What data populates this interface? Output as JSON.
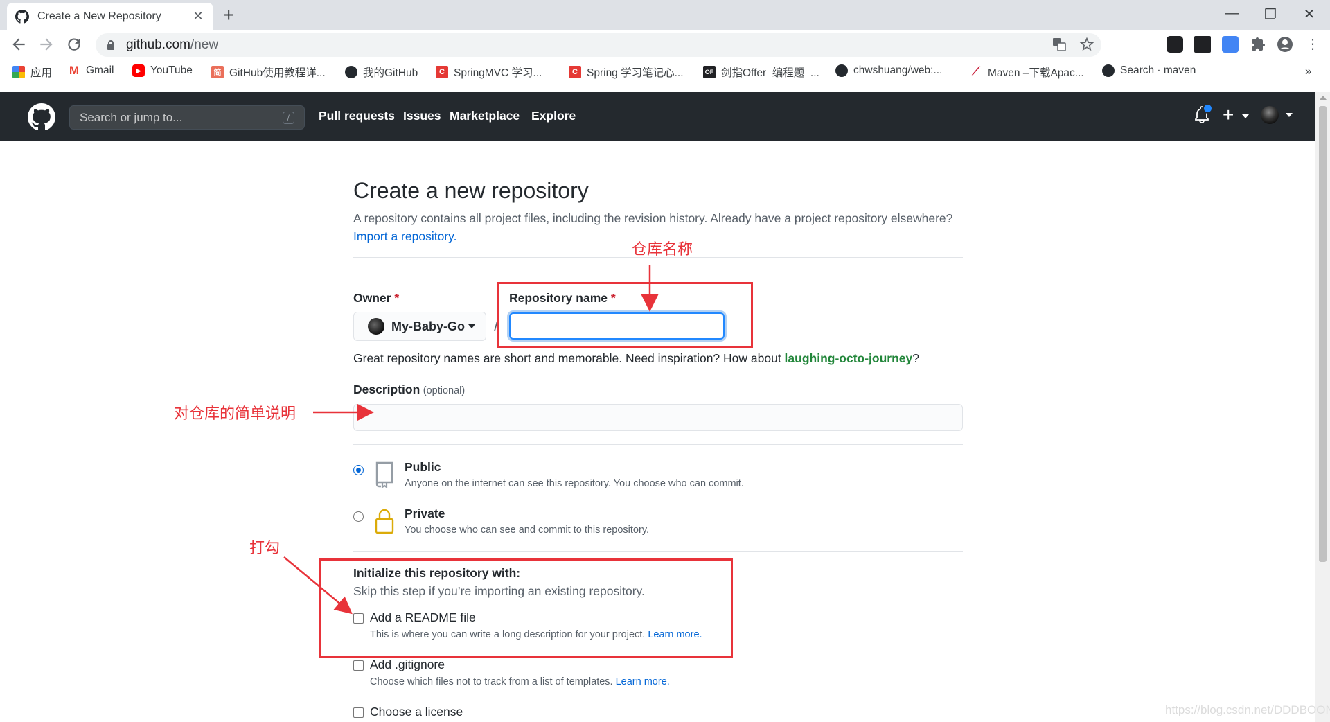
{
  "browser": {
    "tab_title": "Create a New Repository",
    "tab_close": "✕",
    "new_tab": "+",
    "url_host": "github.com",
    "url_path": "/new",
    "window_controls": [
      "—",
      "❐",
      "✕"
    ]
  },
  "bookmarks": [
    {
      "label": "应用",
      "icon": "apps-icon"
    },
    {
      "label": "Gmail",
      "icon": "gmail-icon"
    },
    {
      "label": "YouTube",
      "icon": "youtube-icon"
    },
    {
      "label": "GitHub使用教程详...",
      "icon": "jianshu-icon"
    },
    {
      "label": "我的GitHub",
      "icon": "github-icon"
    },
    {
      "label": "SpringMVC 学习...",
      "icon": "csdn-icon"
    },
    {
      "label": "Spring 学习笔记心...",
      "icon": "csdn-icon"
    },
    {
      "label": "剑指Offer_编程题_...",
      "icon": "nowcoder-icon"
    },
    {
      "label": "chwshuang/web:...",
      "icon": "github-icon"
    },
    {
      "label": "Maven –下载Apac...",
      "icon": "maven-icon"
    },
    {
      "label": "Search · maven",
      "icon": "github-icon"
    }
  ],
  "bookmarks_more": "»",
  "github_header": {
    "search_placeholder": "Search or jump to...",
    "search_shortcut": "/",
    "nav": [
      "Pull requests",
      "Issues",
      "Marketplace",
      "Explore"
    ],
    "plus": "+"
  },
  "form": {
    "title": "Create a new repository",
    "lead": "A repository contains all project files, including the revision history. Already have a project repository elsewhere?",
    "import_link": "Import a repository.",
    "owner_label": "Owner",
    "required_mark": "*",
    "owner_value": "My-Baby-Go",
    "separator": "/",
    "repo_label": "Repository name",
    "repo_value": "",
    "hint_prefix": "Great repository names are short and memorable. Need inspiration? How about ",
    "hint_suggestion": "laughing-octo-journey",
    "hint_suffix": "?",
    "description_label": "Description",
    "description_optional": "(optional)",
    "description_value": "",
    "visibility": [
      {
        "title": "Public",
        "note": "Anyone on the internet can see this repository. You choose who can commit.",
        "selected": true
      },
      {
        "title": "Private",
        "note": "You choose who can see and commit to this repository.",
        "selected": false
      }
    ],
    "init_title": "Initialize this repository with:",
    "init_note": "Skip this step if you’re importing an existing repository.",
    "init_options": [
      {
        "title": "Add a README file",
        "note": "This is where you can write a long description for your project.",
        "link": "Learn more.",
        "checked": false
      },
      {
        "title": "Add .gitignore",
        "note": "Choose which files not to track from a list of templates.",
        "link": "Learn more.",
        "checked": false
      },
      {
        "title": "Choose a license",
        "note": "",
        "link": "",
        "checked": false
      }
    ]
  },
  "annotations": {
    "repo_name": "仓库名称",
    "description": "对仓库的简单说明",
    "check": "打勾",
    "color": "#e8333a"
  },
  "watermark": "https://blog.csdn.net/DDDBOON"
}
